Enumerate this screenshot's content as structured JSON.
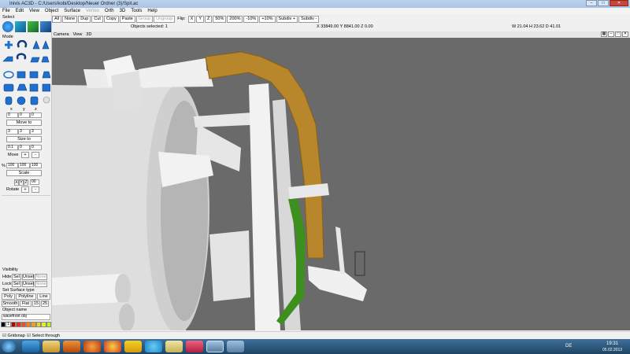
{
  "window": {
    "title": "Inivis AC3D - C:/Users/kobi/Desktop/Neuer Ordner (3)/Spit.ac",
    "minimize": "–",
    "maximize": "□",
    "close": "✕"
  },
  "menu": {
    "items": [
      "File",
      "Edit",
      "View",
      "Object",
      "Surface"
    ],
    "disabled": "Vertex",
    "items2": [
      "Orth",
      "3D",
      "Tools",
      "Help"
    ]
  },
  "select_label": "Select",
  "toolbar": {
    "all": "All",
    "none": "None",
    "dup": "Dup",
    "cut": "Cut",
    "copy": "Copy",
    "paste": "Paste",
    "group": "Group",
    "ungroup": "Ungroup",
    "flip_label": "Flip:",
    "x": "X",
    "y": "Y",
    "z": "Z",
    "zoom50": "50%",
    "zoom200": "200%",
    "minus10": "-10%",
    "plus10": "+10%",
    "subdiv_plus": "Subdiv +",
    "subdiv_minus": "Subdiv -"
  },
  "status": {
    "objects_selected": "Objects selected: 1",
    "coords": "X 33849.00 Y 8841.00 Z 0.00",
    "dims": "W 21.04 H 23.62 D 41.01"
  },
  "camera_bar": {
    "camera": "Camera",
    "view": "View",
    "mode": "3D"
  },
  "panel": {
    "mode": "Mode",
    "xyz": [
      "x",
      "y",
      "z"
    ],
    "move_to_vals": [
      "0",
      "0",
      "0"
    ],
    "move_to": "Move to",
    "size_vals": [
      "3",
      "3",
      "3"
    ],
    "size_to": "Size to",
    "move_vals": [
      "0.1",
      "0",
      "0"
    ],
    "move": "Move",
    "plus": "+",
    "minus": "-",
    "scale_pct": "%",
    "scale_vals": [
      "100",
      "100",
      "100"
    ],
    "scale": "Scale",
    "axes": [
      "X",
      "Y",
      "Z"
    ],
    "rot_val": "00",
    "rotate": "Rotate",
    "visibility": "Visibility",
    "hide": "Hide:",
    "lock": "Lock:",
    "sel": "Sel",
    "unsel": "Unsel",
    "none": "None",
    "set_surface": "Set Surface type",
    "poly": "Poly",
    "polyline": "Polyline",
    "line": "Line",
    "smooth": "Smooth",
    "flat": "Flat",
    "n15": "15",
    "n25": "25",
    "object_name": "Object name",
    "object_value": "wavefront obj",
    "palette": [
      "#000000",
      "#ffffff",
      "#c00000",
      "#e03020",
      "#f05020",
      "#f08020",
      "#f0a020",
      "#f0d020",
      "#e0f020",
      "#c0f020"
    ],
    "palette_label": "1"
  },
  "bottom": {
    "gridsnap": "Gridsnap",
    "select_through": "Select through"
  },
  "taskbar": {
    "lang": "DE",
    "time": "19:31",
    "date": "05.02.2013",
    "apps": [
      "start-orb",
      "ie",
      "explorer",
      "media-player",
      "firefox",
      "chrome",
      "misc-yellow",
      "skype",
      "note",
      "ac3d-app",
      "network-app",
      "image-app"
    ]
  },
  "colors": {
    "viewport_bg": "#6a6a6a",
    "pipe_orange": "#b8872c",
    "pipe_green": "#3d8f1e"
  }
}
